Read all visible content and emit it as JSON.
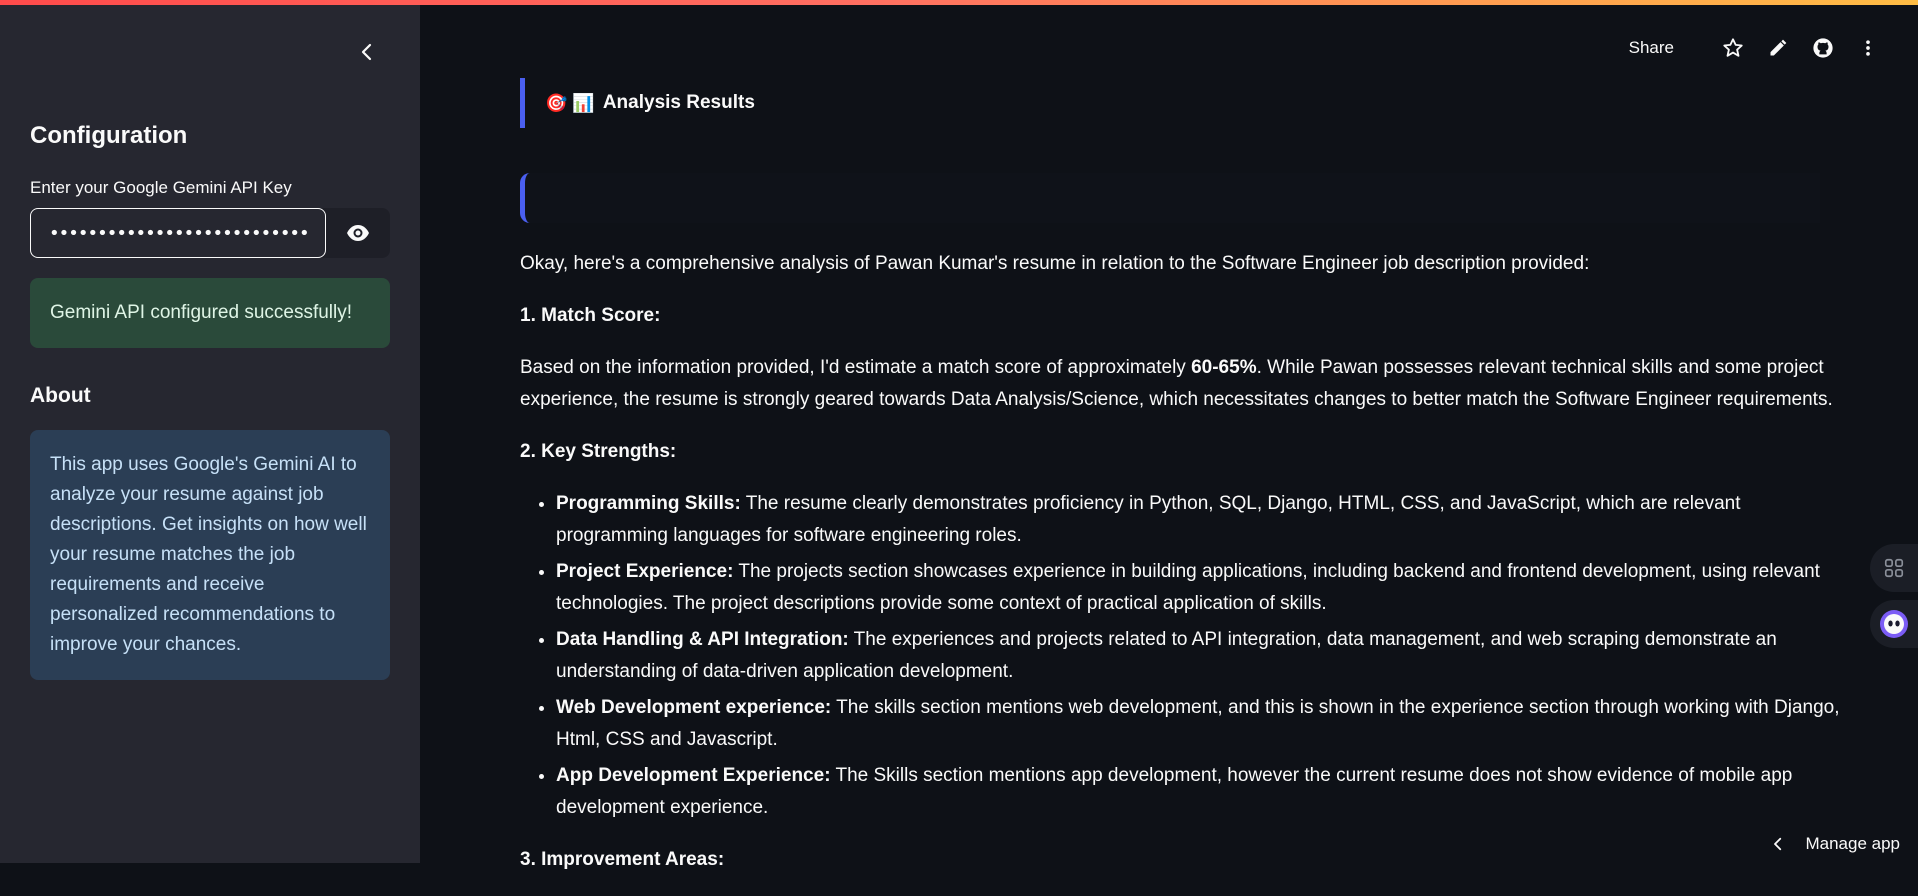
{
  "sidebar": {
    "collapse_icon": "chevron-left-icon",
    "title": "Configuration",
    "api_key_label": "Enter your Google Gemini API Key",
    "api_key_value": "••••••••••••••••••••••••••••••••••••••",
    "visibility_icon": "eye-icon",
    "success_message": "Gemini API configured successfully!",
    "about_title": "About",
    "about_text": "This app uses Google's Gemini AI to analyze your resume against job descriptions. Get insights on how well your resume matches the job requirements and receive personalized recommendations to improve your chances."
  },
  "toolbar": {
    "share_label": "Share",
    "icons": [
      "star-icon",
      "edit-pencil-icon",
      "github-icon",
      "more-vertical-icon"
    ]
  },
  "main": {
    "header_emojis": "🎯 📊",
    "header_title": "Analysis Results",
    "intro": "Okay, here's a comprehensive analysis of Pawan Kumar's resume in relation to the Software Engineer job description provided:",
    "match_heading": "1. Match Score:",
    "match_text_pre": "Based on the information provided, I'd estimate a match score of approximately ",
    "match_score": "60-65%",
    "match_text_post": ". While Pawan possesses relevant technical skills and some project experience, the resume is strongly geared towards Data Analysis/Science, which necessitates changes to better match the Software Engineer requirements.",
    "strengths_heading": "2. Key Strengths:",
    "strengths": [
      {
        "title": "Programming Skills:",
        "text": " The resume clearly demonstrates proficiency in Python, SQL, Django, HTML, CSS, and JavaScript, which are relevant programming languages for software engineering roles."
      },
      {
        "title": "Project Experience:",
        "text": " The projects section showcases experience in building applications, including backend and frontend development, using relevant technologies. The project descriptions provide some context of practical application of skills."
      },
      {
        "title": "Data Handling & API Integration:",
        "text": " The experiences and projects related to API integration, data management, and web scraping demonstrate an understanding of data-driven application development."
      },
      {
        "title": "Web Development experience:",
        "text": " The skills section mentions web development, and this is shown in the experience section through working with Django, Html, CSS and Javascript."
      },
      {
        "title": "App Development Experience:",
        "text": " The Skills section mentions app development, however the current resume does not show evidence of mobile app development experience."
      }
    ],
    "improvement_heading": "3. Improvement Areas:"
  },
  "widgets": {
    "grid_icon": "command-grid-icon",
    "assistant_icon": "assistant-bot-icon"
  },
  "manage_app": {
    "label": "Manage app",
    "icon": "chevron-left-icon"
  },
  "colors": {
    "background": "#0e1117",
    "sidebar": "#262730",
    "accent": "#4a5ff0",
    "success_bg": "#2a4a3a",
    "info_bg": "#2b3e55"
  }
}
